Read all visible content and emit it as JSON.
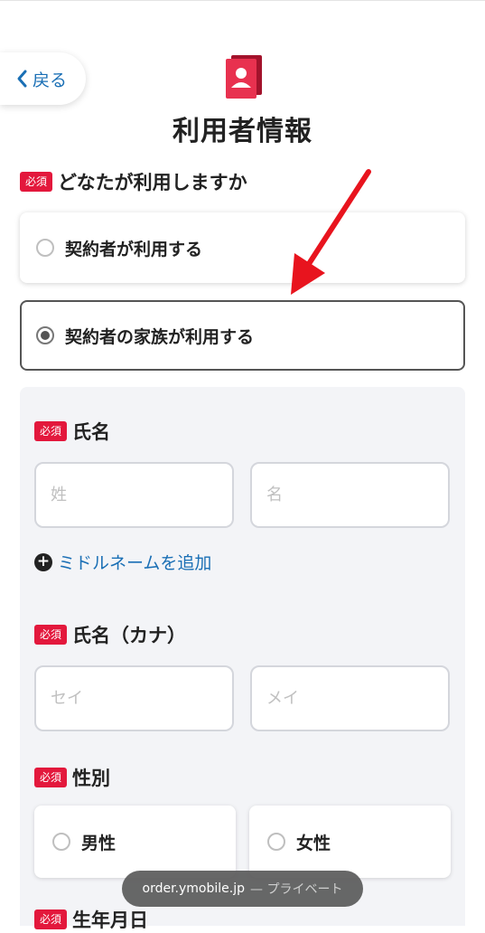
{
  "nav": {
    "back_label": "戻る"
  },
  "page": {
    "title": "利用者情報"
  },
  "question": {
    "required_badge": "必須",
    "label": "どなたが利用しますか",
    "options": [
      {
        "label": "契約者が利用する",
        "selected": false
      },
      {
        "label": "契約者の家族が利用する",
        "selected": true
      }
    ]
  },
  "name": {
    "required_badge": "必須",
    "label": "氏名",
    "last_placeholder": "姓",
    "first_placeholder": "名",
    "add_middle_label": "ミドルネームを追加"
  },
  "name_kana": {
    "required_badge": "必須",
    "label": "氏名（カナ）",
    "last_placeholder": "セイ",
    "first_placeholder": "メイ"
  },
  "gender": {
    "required_badge": "必須",
    "label": "性別",
    "options": [
      "男性",
      "女性"
    ]
  },
  "birthdate": {
    "required_badge": "必須",
    "label": "生年月日"
  },
  "browser_toast": {
    "domain": "order.ymobile.jp",
    "mode": "— プライベート"
  },
  "colors": {
    "required": "#e3183c",
    "link": "#1a6fb5",
    "annotation_arrow": "#e8141e",
    "panel_bg": "#f3f4f7"
  }
}
